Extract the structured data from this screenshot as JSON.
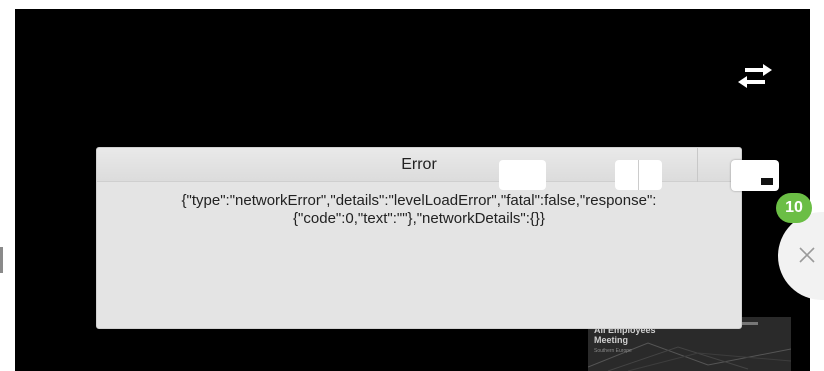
{
  "error_dialog": {
    "title": "Error",
    "message": "{\"type\":\"networkError\",\"details\":\"levelLoadError\",\"fatal\":false,\"response\":{\"code\":0,\"text\":\"\"},\"networkDetails\":{}}"
  },
  "thumbnail": {
    "title": "All Employees Meeting",
    "subtitle": "Southern Europe"
  },
  "notification": {
    "count": "10",
    "badge_color": "#6bbe45"
  },
  "icons": {
    "swap": "swap-arrows-icon",
    "close": "close-icon"
  },
  "colors": {
    "player_background": "#000000",
    "dialog_background": "#e4e4e4"
  }
}
